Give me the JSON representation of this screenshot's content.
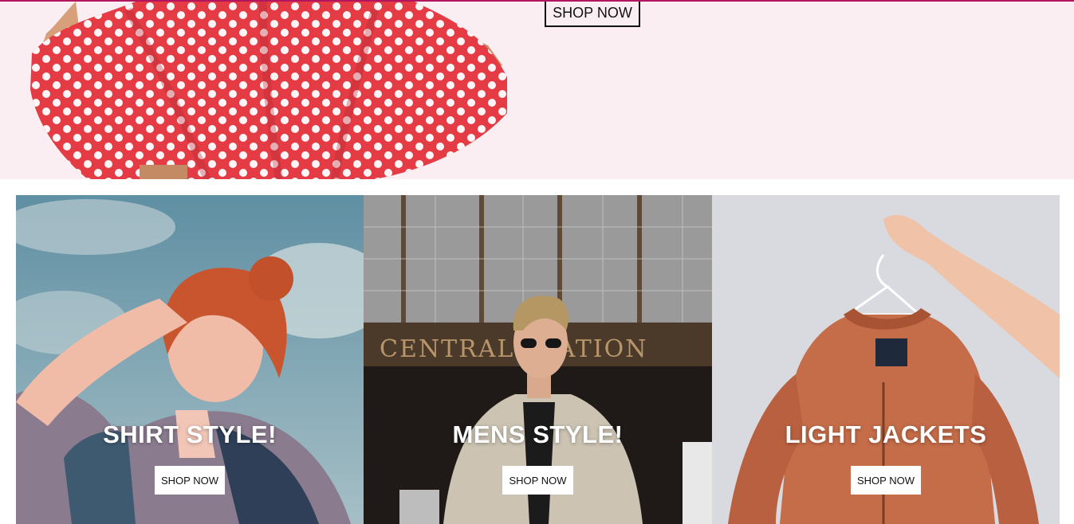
{
  "hero": {
    "shop_now_label": "SHOP NOW",
    "image": "polka-dot-dress-photo"
  },
  "tiles": [
    {
      "title": "SHIRT STYLE!",
      "button_label": "SHOP NOW",
      "image": "woman-in-patterned-shirt-photo"
    },
    {
      "title": "MENS STYLE!",
      "button_label": "SHOP NOW",
      "image": "man-at-station-photo"
    },
    {
      "title": "LIGHT JACKETS",
      "button_label": "SHOP NOW",
      "image": "jacket-on-hanger-photo"
    }
  ],
  "photo_signage": {
    "station_sign": "CENTRAL STATION"
  },
  "colors": {
    "accent_line": "#b3155e",
    "hero_background": "#fbeef3",
    "dress_red": "#e43b45"
  }
}
